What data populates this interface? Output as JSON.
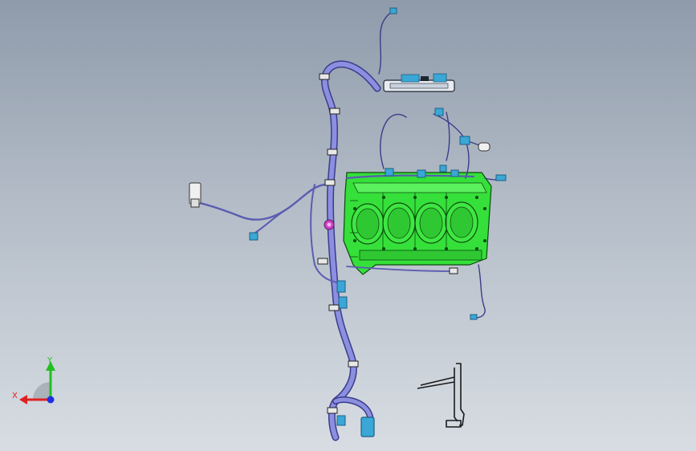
{
  "viewport": {
    "model": "engine-block-wiring-harness",
    "colors": {
      "background_top": "#8f9bab",
      "background_bottom": "#d8dde3",
      "engine_block": "#35e03a",
      "engine_block_dark": "#1f8a22",
      "harness": "#8c8fe0",
      "harness_outline": "#3a3d8a",
      "connector": "#3aa7d6",
      "connector_dark": "#1d5f85",
      "bracket": "#2a2a2a",
      "magenta_part": "#d040c8"
    }
  },
  "triad": {
    "x_label": "X",
    "y_label": "Y",
    "x_color": "#e02020",
    "y_color": "#20c020",
    "z_color": "#2030e0"
  }
}
